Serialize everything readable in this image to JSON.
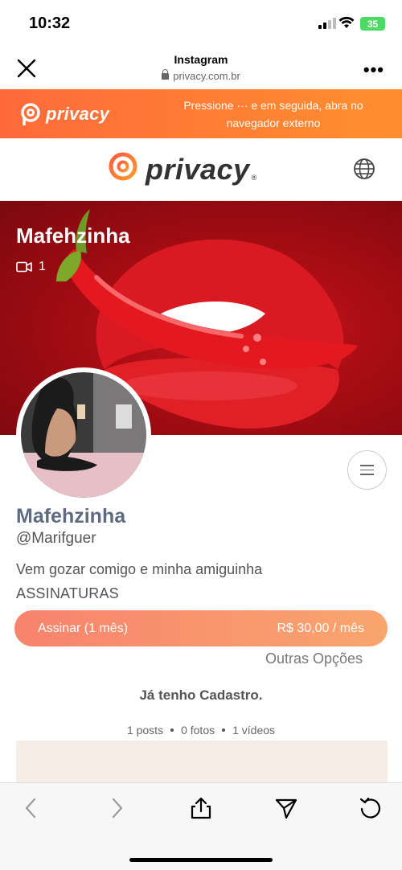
{
  "status_bar": {
    "time": "10:32",
    "battery": "35"
  },
  "browser": {
    "title": "Instagram",
    "url": "privacy.com.br"
  },
  "banner": {
    "brand": "privacy",
    "message": "Pressione ··· e em seguida, abra no navegador externo"
  },
  "site": {
    "brand": "privacy",
    "registered": "®"
  },
  "cover": {
    "name": "Mafehzinha",
    "video_count": "1"
  },
  "profile": {
    "name": "Mafehzinha",
    "handle": "@Marifguer",
    "bio": "Vem gozar comigo e minha amiguinha",
    "subscriptions_title": "ASSINATURAS"
  },
  "subscription": {
    "label": "Assinar (1 mês)",
    "price": "R$ 30,00 / mês",
    "other_options": "Outras Opções"
  },
  "login": {
    "have_account": "Já tenho Cadastro."
  },
  "stats": {
    "posts": "1 posts",
    "photos": "0 fotos",
    "videos": "1 vídeos"
  },
  "colors": {
    "brand_orange": "#ff6a3b",
    "cover_red": "#c9141c",
    "name_color": "#5f6b80"
  },
  "icons": {
    "close": "close-icon",
    "more": "more-icon",
    "globe": "globe-icon",
    "video": "video-icon",
    "menu": "hamburger-icon",
    "back": "chevron-left-icon",
    "forward": "chevron-right-icon",
    "share": "share-icon",
    "send": "send-icon",
    "reload": "reload-icon"
  }
}
